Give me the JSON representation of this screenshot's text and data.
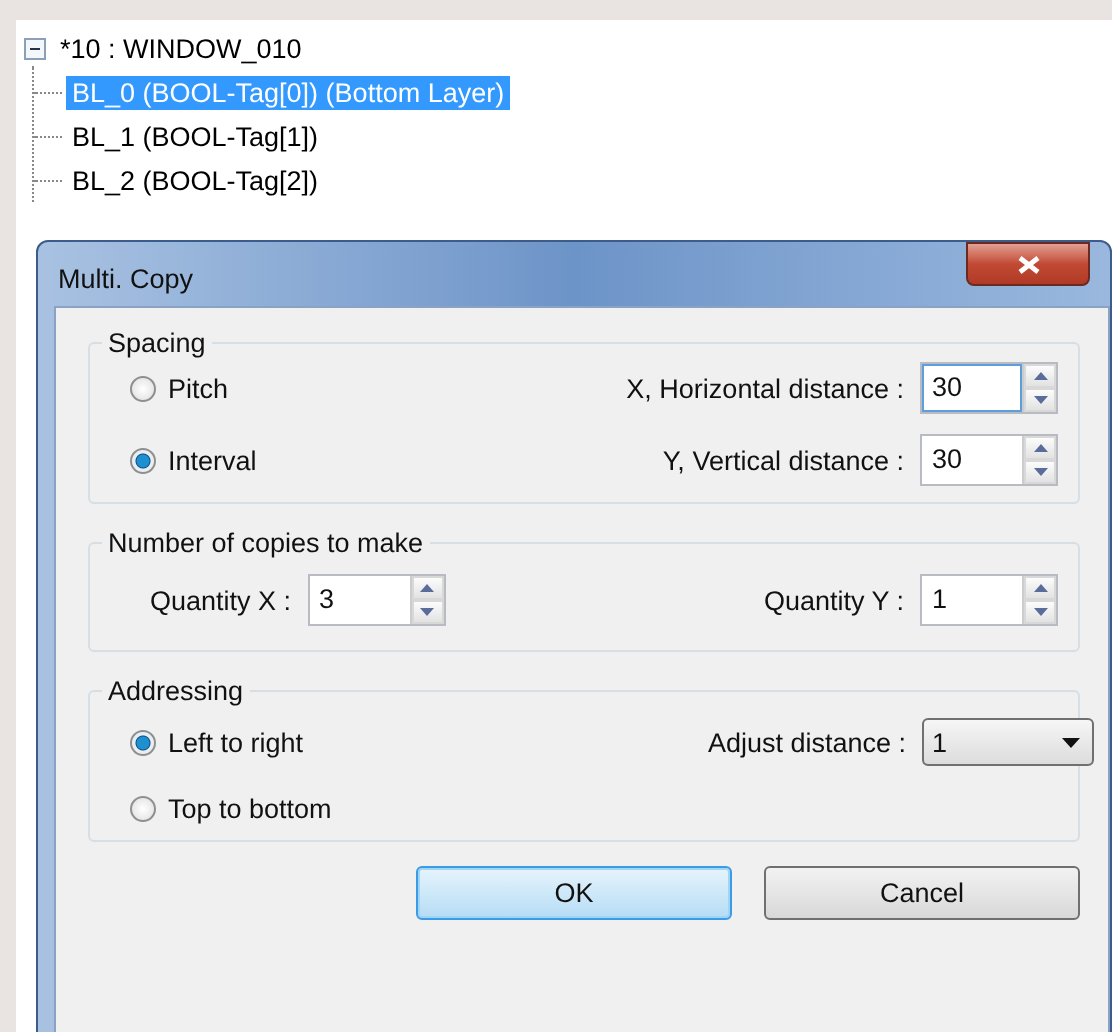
{
  "tree": {
    "label": "*10 : WINDOW_010",
    "expanded": true,
    "children": [
      {
        "label": "BL_0 (BOOL-Tag[0]) (Bottom Layer)",
        "selected": true
      },
      {
        "label": "BL_1 (BOOL-Tag[1])",
        "selected": false
      },
      {
        "label": "BL_2 (BOOL-Tag[2])",
        "selected": false
      }
    ]
  },
  "dialog": {
    "title": "Multi. Copy",
    "spacing": {
      "title": "Spacing",
      "options": [
        {
          "label": "Pitch",
          "selected": false
        },
        {
          "label": "Interval",
          "selected": true
        }
      ],
      "fields": [
        {
          "label": "X, Horizontal distance :",
          "value": "30",
          "focused": true
        },
        {
          "label": "Y, Vertical distance :",
          "value": "30",
          "focused": false
        }
      ]
    },
    "copies": {
      "title": "Number of copies to make",
      "fields": [
        {
          "label": "Quantity X  :",
          "value": "3",
          "focused": false
        },
        {
          "label": "Quantity Y :",
          "value": "1",
          "focused": false
        }
      ]
    },
    "addressing": {
      "title": "Addressing",
      "options": [
        {
          "label": "Left to right",
          "selected": true
        },
        {
          "label": "Top to bottom",
          "selected": false
        }
      ],
      "adjust": {
        "label": "Adjust distance :",
        "value": "1"
      }
    },
    "buttons": [
      {
        "label": "OK",
        "default": true
      },
      {
        "label": "Cancel",
        "default": false
      }
    ]
  }
}
